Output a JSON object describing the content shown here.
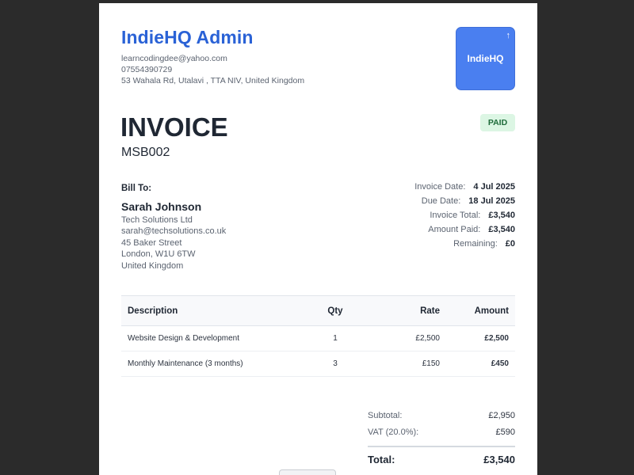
{
  "company": {
    "name": "IndieHQ Admin",
    "email": "learncodingdee@yahoo.com",
    "phone": "07554390729",
    "address": "53 Wahala Rd, Utalavi , TTA NIV, United Kingdom",
    "logo_text": "IndieHQ",
    "logo_icon": "arrow-up-icon",
    "logo_color": "#4a7ff0"
  },
  "invoice": {
    "heading": "INVOICE",
    "number": "MSB002",
    "status": "PAID",
    "status_color": "#dcf6e4"
  },
  "bill_to": {
    "label": "Bill To:",
    "name": "Sarah Johnson",
    "company": "Tech Solutions Ltd",
    "email": "sarah@techsolutions.co.uk",
    "street": "45 Baker Street",
    "city": "London, W1U 6TW",
    "country": "United Kingdom"
  },
  "summary": [
    {
      "label": "Invoice Date:",
      "value": "4 Jul 2025"
    },
    {
      "label": "Due Date:",
      "value": "18 Jul 2025"
    },
    {
      "label": "Invoice Total:",
      "value": "£3,540"
    },
    {
      "label": "Amount Paid:",
      "value": "£3,540"
    },
    {
      "label": "Remaining:",
      "value": "£0"
    }
  ],
  "table": {
    "headers": {
      "description": "Description",
      "qty": "Qty",
      "rate": "Rate",
      "amount": "Amount"
    },
    "rows": [
      {
        "description": "Website Design & Development",
        "qty": "1",
        "rate": "£2,500",
        "amount": "£2,500"
      },
      {
        "description": "Monthly Maintenance (3 months)",
        "qty": "3",
        "rate": "£150",
        "amount": "£450"
      }
    ]
  },
  "totals": {
    "subtotal_label": "Subtotal:",
    "subtotal": "£2,950",
    "vat_label": "VAT (20.0%):",
    "vat": "£590",
    "total_label": "Total:",
    "total": "£3,540"
  }
}
